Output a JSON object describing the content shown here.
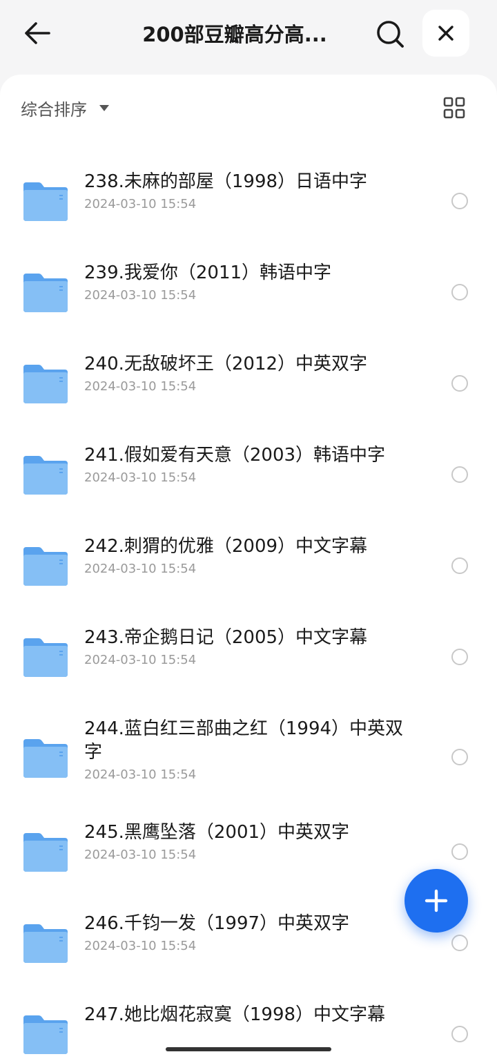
{
  "header": {
    "title": "200部豆瓣高分高..."
  },
  "toolbar": {
    "sort_label": "综合排序"
  },
  "icons": {
    "back": "arrow-left-icon",
    "search": "search-icon",
    "close": "close-icon",
    "grid": "grid-view-icon",
    "folder": "folder-icon",
    "add": "plus-icon"
  },
  "colors": {
    "accent": "#1e6ff0",
    "folder": "#7bb8f4",
    "folder_dark": "#5aa3ee"
  },
  "files": [
    {
      "name": "238.未麻的部屋（1998）日语中字",
      "date": "2024-03-10 15:54"
    },
    {
      "name": "239.我爱你（2011）韩语中字",
      "date": "2024-03-10 15:54"
    },
    {
      "name": "240.无敌破坏王（2012）中英双字",
      "date": "2024-03-10 15:54"
    },
    {
      "name": "241.假如爱有天意（2003）韩语中字",
      "date": "2024-03-10 15:54"
    },
    {
      "name": "242.刺猬的优雅（2009）中文字幕",
      "date": "2024-03-10 15:54"
    },
    {
      "name": "243.帝企鹅日记（2005）中文字幕",
      "date": "2024-03-10 15:54"
    },
    {
      "name": "244.蓝白红三部曲之红（1994）中英双字",
      "date": "2024-03-10 15:54"
    },
    {
      "name": "245.黑鹰坠落（2001）中英双字",
      "date": "2024-03-10 15:54"
    },
    {
      "name": "246.千钧一发（1997）中英双字",
      "date": "2024-03-10 15:54"
    },
    {
      "name": "247.她比烟花寂寞（1998）中文字幕",
      "date": ""
    }
  ]
}
